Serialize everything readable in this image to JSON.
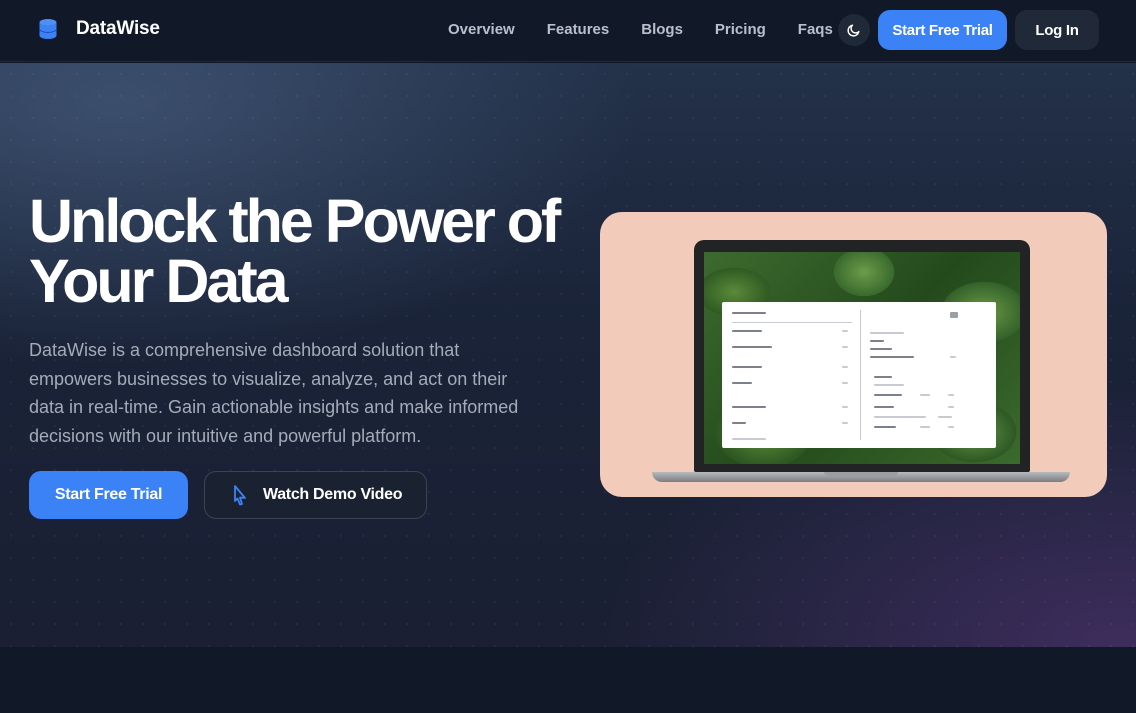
{
  "brand": {
    "name": "DataWise",
    "icon": "database-icon"
  },
  "nav": {
    "links": [
      "Overview",
      "Features",
      "Blogs",
      "Pricing",
      "Faqs"
    ],
    "theme_toggle_icon": "moon-icon",
    "trial_label": "Start Free Trial",
    "login_label": "Log In"
  },
  "hero": {
    "title_line1": "Unlock the Power of",
    "title_line2": "Your Data",
    "description": "DataWise is a comprehensive dashboard solution that empowers businesses to visualize, analyze, and act on their data in real-time. Gain actionable insights and make informed decisions with our intuitive and powerful platform.",
    "primary_cta": "Start Free Trial",
    "secondary_cta": "Watch Demo Video",
    "secondary_cta_icon": "play-cursor-icon"
  },
  "colors": {
    "accent": "#3b82f6",
    "background": "#111827",
    "card": "#f3cbbb"
  }
}
